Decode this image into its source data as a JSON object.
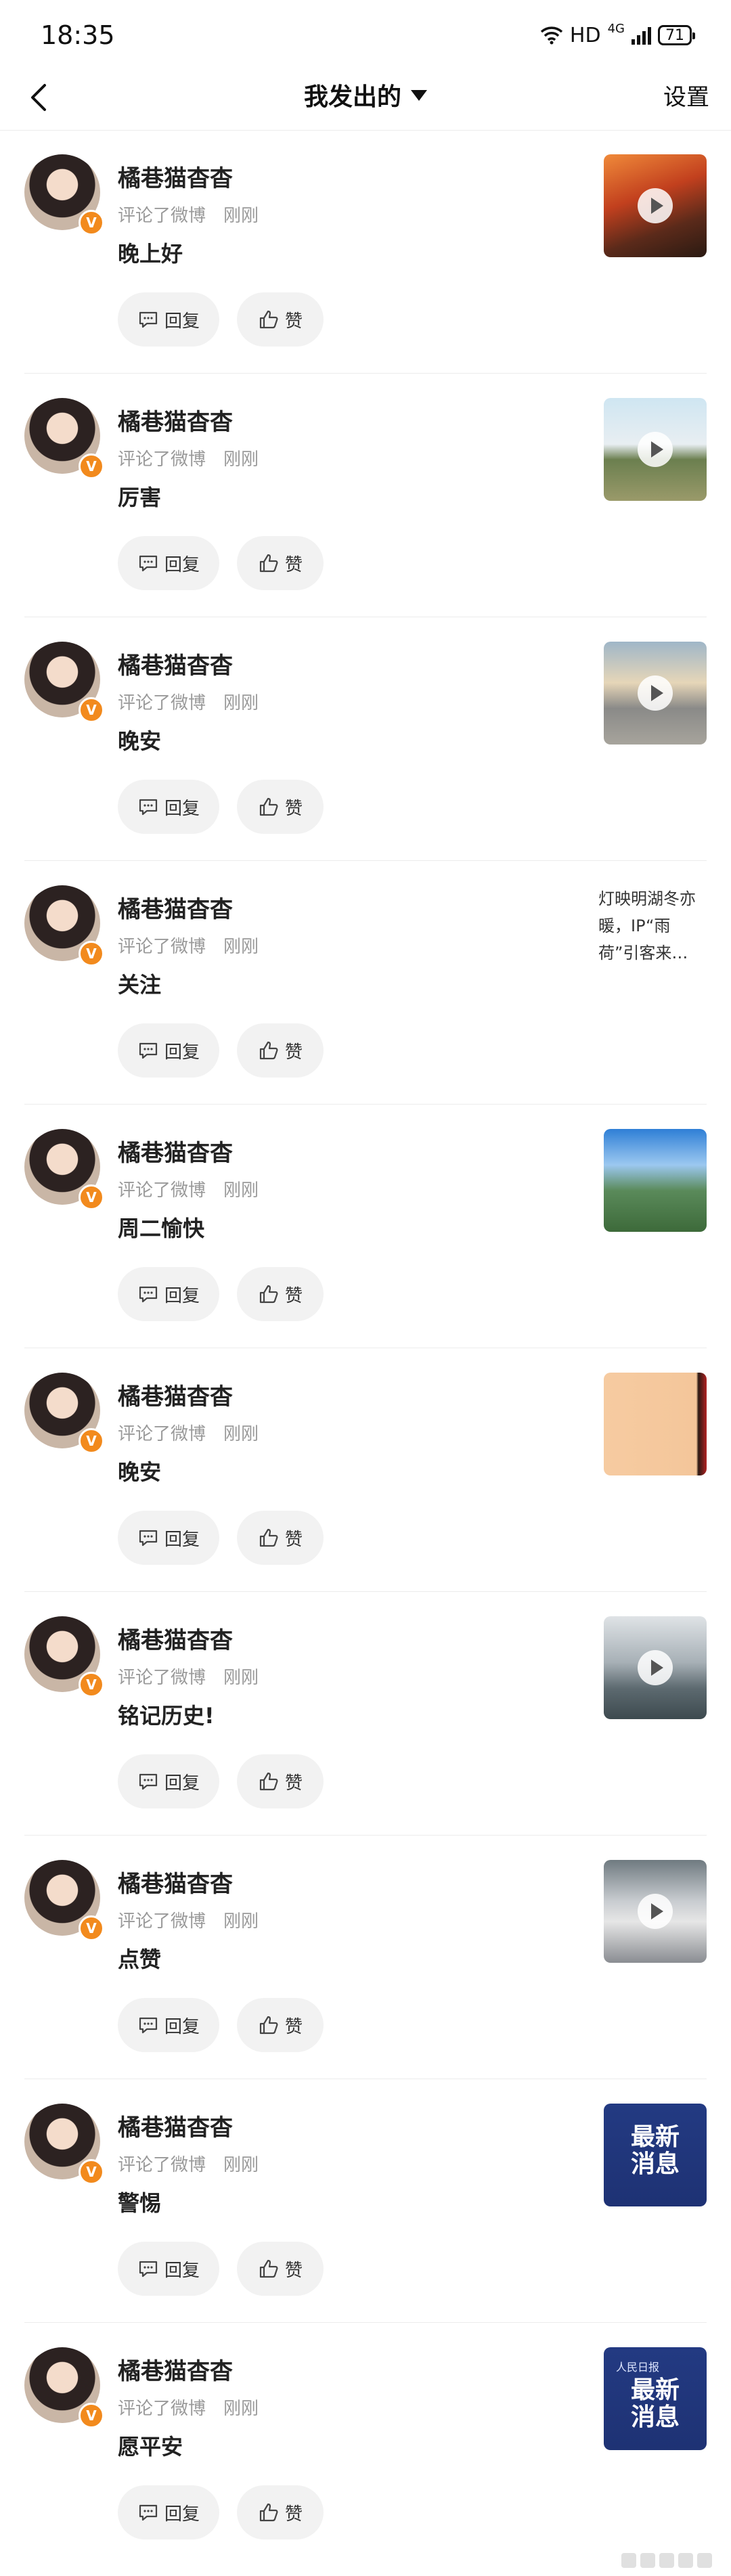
{
  "status": {
    "time": "18:35",
    "hd": "HD",
    "network": "4G",
    "battery": "71"
  },
  "nav": {
    "title": "我发出的",
    "settings": "设置"
  },
  "labels": {
    "reply": "回复",
    "like": "赞",
    "verified": "V"
  },
  "items": [
    {
      "name": "橘巷猫杳杳",
      "action": "评论了微博",
      "time": "刚刚",
      "comment": "晚上好",
      "thumb": "video-autumn-street"
    },
    {
      "name": "橘巷猫杳杳",
      "action": "评论了微博",
      "time": "刚刚",
      "comment": "厉害",
      "thumb": "video-campus-tree"
    },
    {
      "name": "橘巷猫杳杳",
      "action": "评论了微博",
      "time": "刚刚",
      "comment": "晚安",
      "thumb": "video-sunset-building"
    },
    {
      "name": "橘巷猫杳杳",
      "action": "评论了微博",
      "time": "刚刚",
      "comment": "关注",
      "thumb_text": "灯映明湖冬亦暖，IP“雨荷”引客来…"
    },
    {
      "name": "橘巷猫杳杳",
      "action": "评论了微博",
      "time": "刚刚",
      "comment": "周二愉快",
      "thumb": "image-aerial-city"
    },
    {
      "name": "橘巷猫杳杳",
      "action": "评论了微博",
      "time": "刚刚",
      "comment": "晚安",
      "thumb": "image-peach"
    },
    {
      "name": "橘巷猫杳杳",
      "action": "评论了微博",
      "time": "刚刚",
      "comment": "铭记历史!",
      "thumb": "video-memorial"
    },
    {
      "name": "橘巷猫杳杳",
      "action": "评论了微博",
      "time": "刚刚",
      "comment": "点赞",
      "thumb": "video-traffic"
    },
    {
      "name": "橘巷猫杳杳",
      "action": "评论了微博",
      "time": "刚刚",
      "comment": "警惕",
      "thumb_news": "最新\n消息"
    },
    {
      "name": "橘巷猫杳杳",
      "action": "评论了微博",
      "time": "刚刚",
      "comment": "愿平安",
      "thumb_news": "最新\n消息",
      "thumb_news_brand": "人民日报"
    }
  ]
}
